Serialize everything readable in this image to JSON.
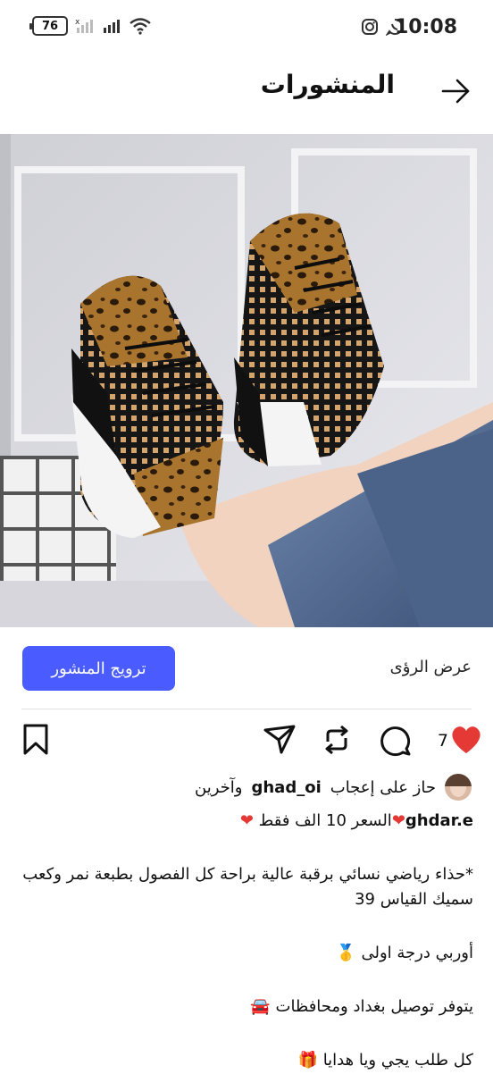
{
  "status_bar": {
    "time": "10:08",
    "battery": "76"
  },
  "header": {
    "title": "المنشورات"
  },
  "post": {
    "promote_label": "ترويج المنشور",
    "insights_label": "عرض الرؤى",
    "like_count": "7",
    "likes_text_prefix": "حاز على إعجاب",
    "likes_user": "ghad_oi",
    "likes_text_suffix": "وآخرين",
    "caption_user": "ghdar.e",
    "caption_line1": "السعر 10 الف فقط",
    "caption_line2": "*حذاء رياضي نسائي برقبة عالية براحة كل الفصول بطبعة نمر وكعب سميك القياس 39",
    "caption_line3": "أوربي درجة اولى",
    "caption_line4": "يتوفر توصيل بغداد ومحافظات",
    "caption_line5": "كل طلب يجي ويا هدايا"
  },
  "colors": {
    "accent": "#4a5cff",
    "like": "#e53935"
  }
}
